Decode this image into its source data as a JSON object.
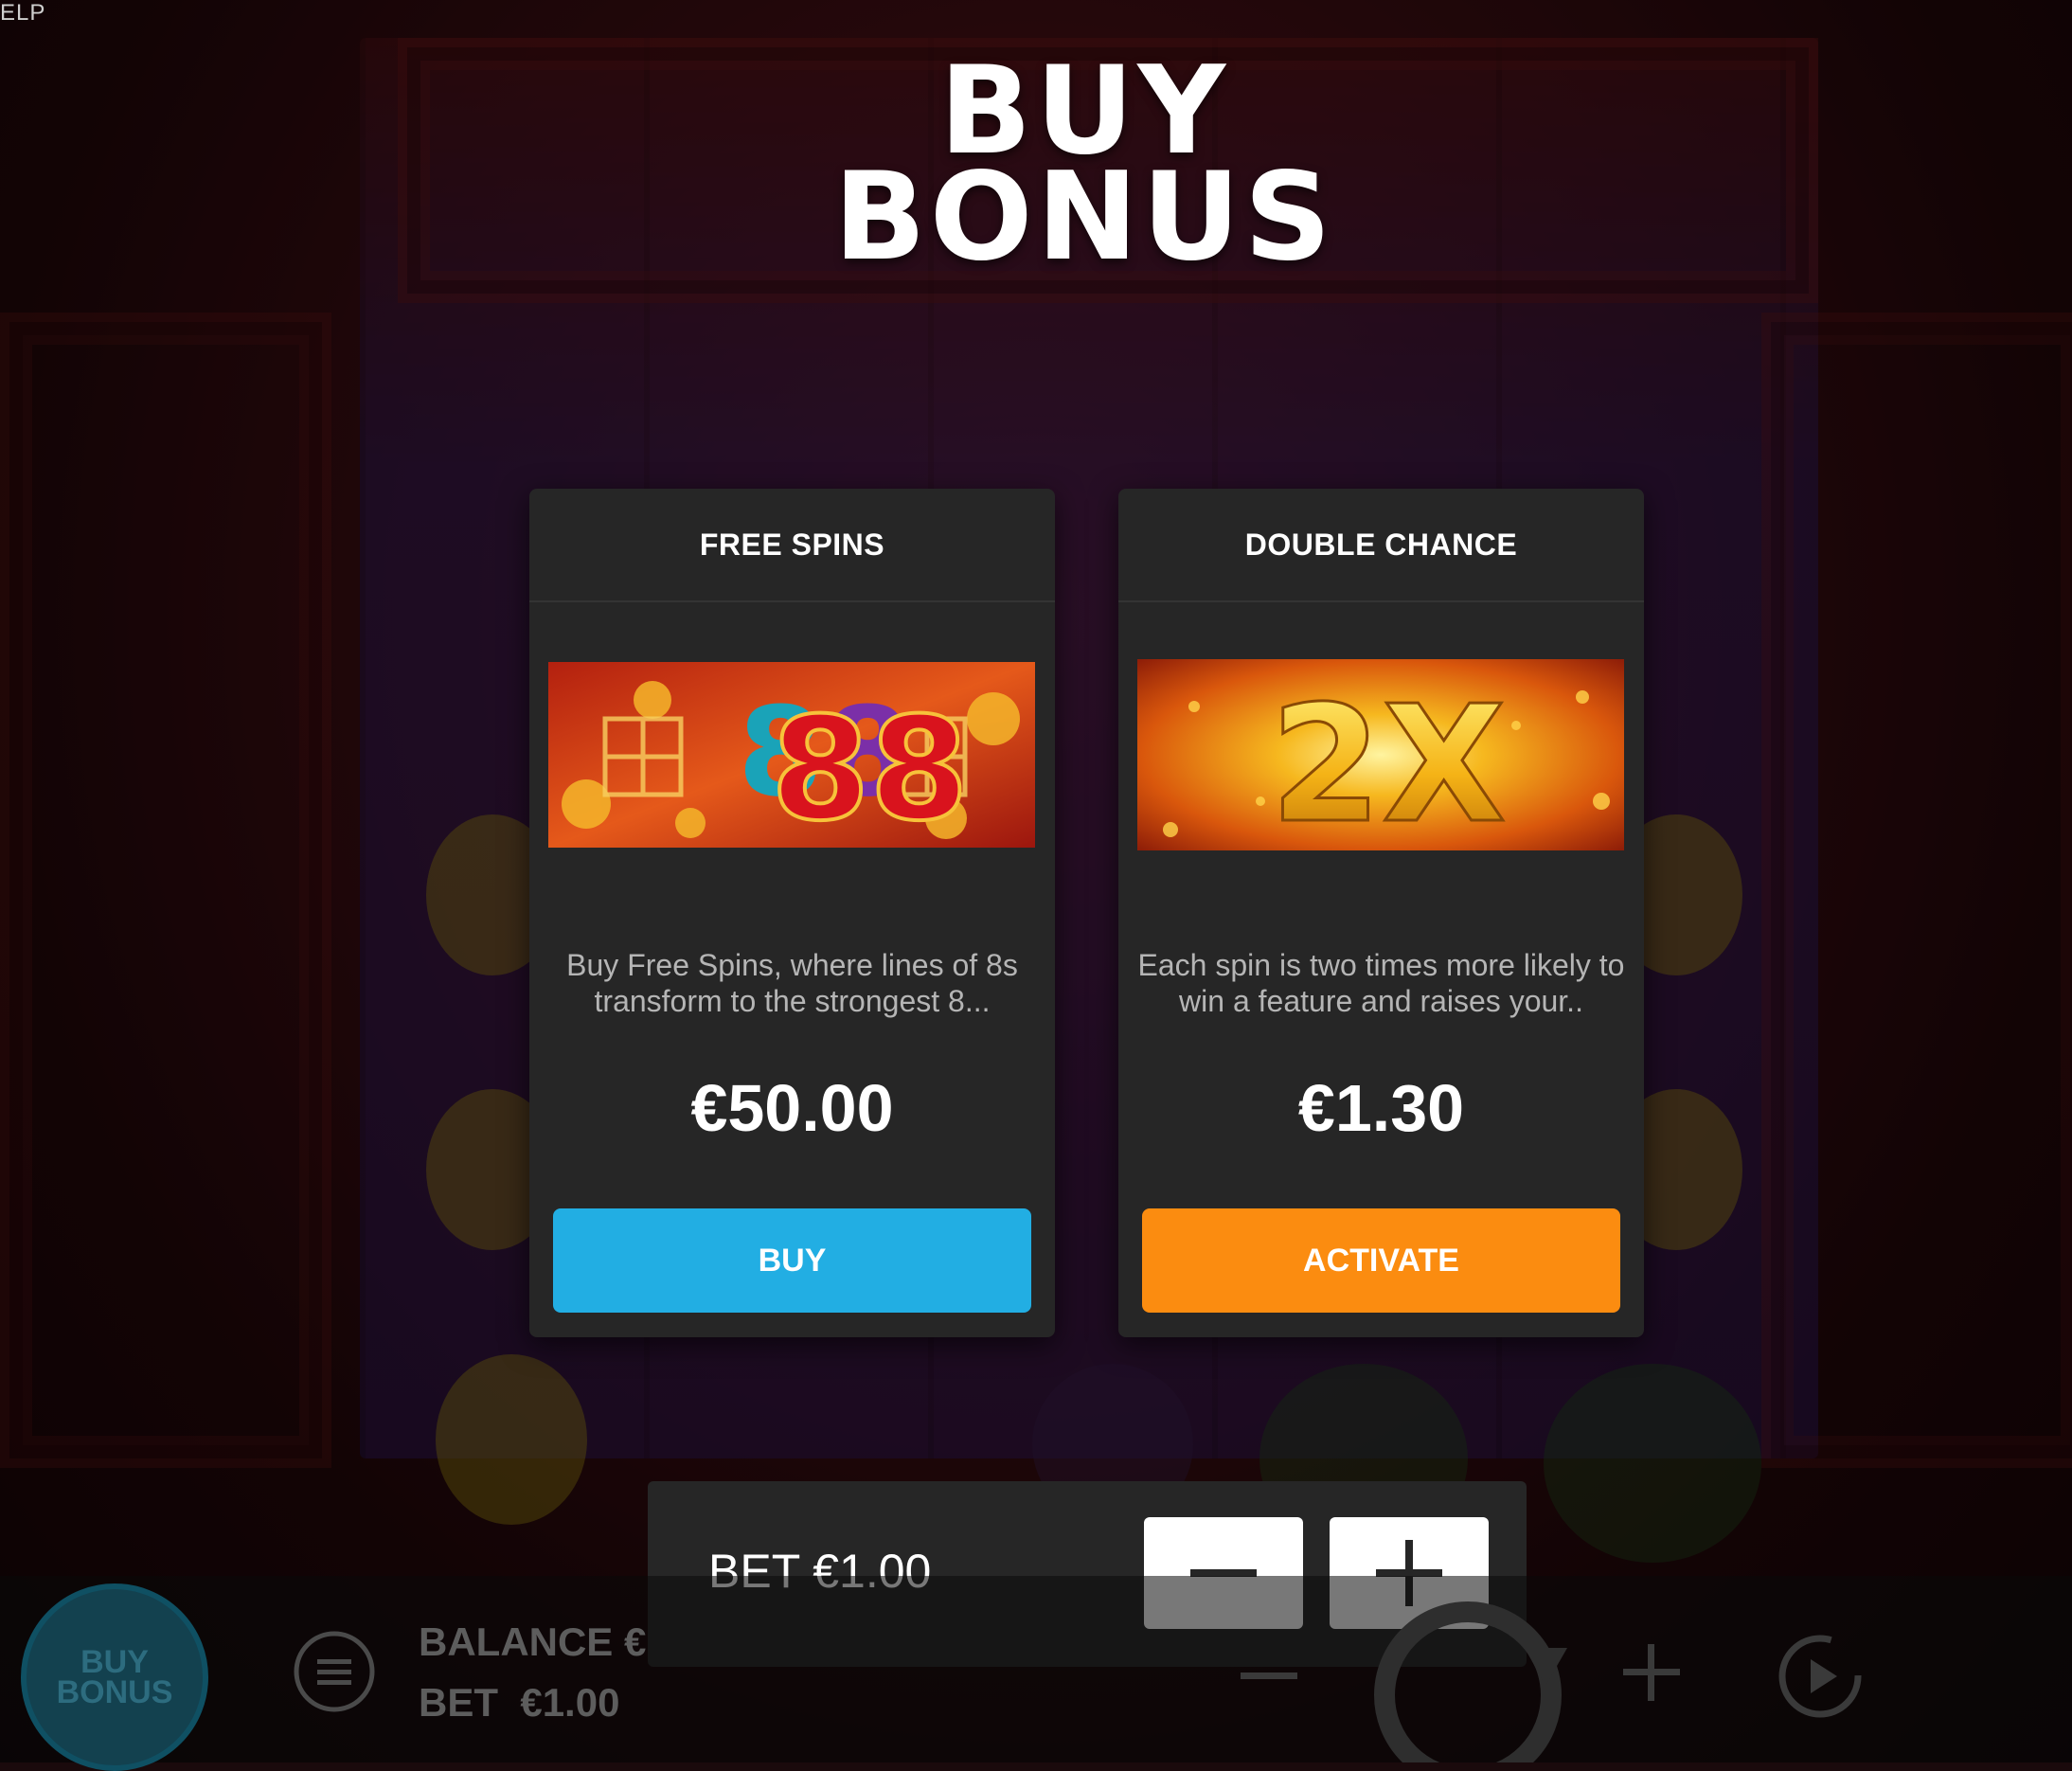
{
  "corner_label": "ELP",
  "title": {
    "line1": "BUY",
    "line2": "BONUS"
  },
  "cards": [
    {
      "name": "FREE SPINS",
      "description": "Buy Free Spins, where lines of 8s transform to the strongest 8...",
      "price": "€50.00",
      "button_label": "BUY",
      "button_color": "#22aee3",
      "image_text": "88"
    },
    {
      "name": "DOUBLE CHANCE",
      "description": "Each spin is two times more likely to win a feature and raises your..",
      "price": "€1.30",
      "button_label": "ACTIVATE",
      "button_color": "#fb8c10",
      "image_text": "2X"
    }
  ],
  "bet_panel": {
    "label": "BET €1.00",
    "minus_icon": "minus-icon",
    "plus_icon": "plus-icon"
  },
  "bottom_bar": {
    "buy_bonus_line1": "BUY",
    "buy_bonus_line2": "BONUS",
    "balance_label": "BALANCE €",
    "bet_label": "BET",
    "bet_value": "€1.00"
  }
}
